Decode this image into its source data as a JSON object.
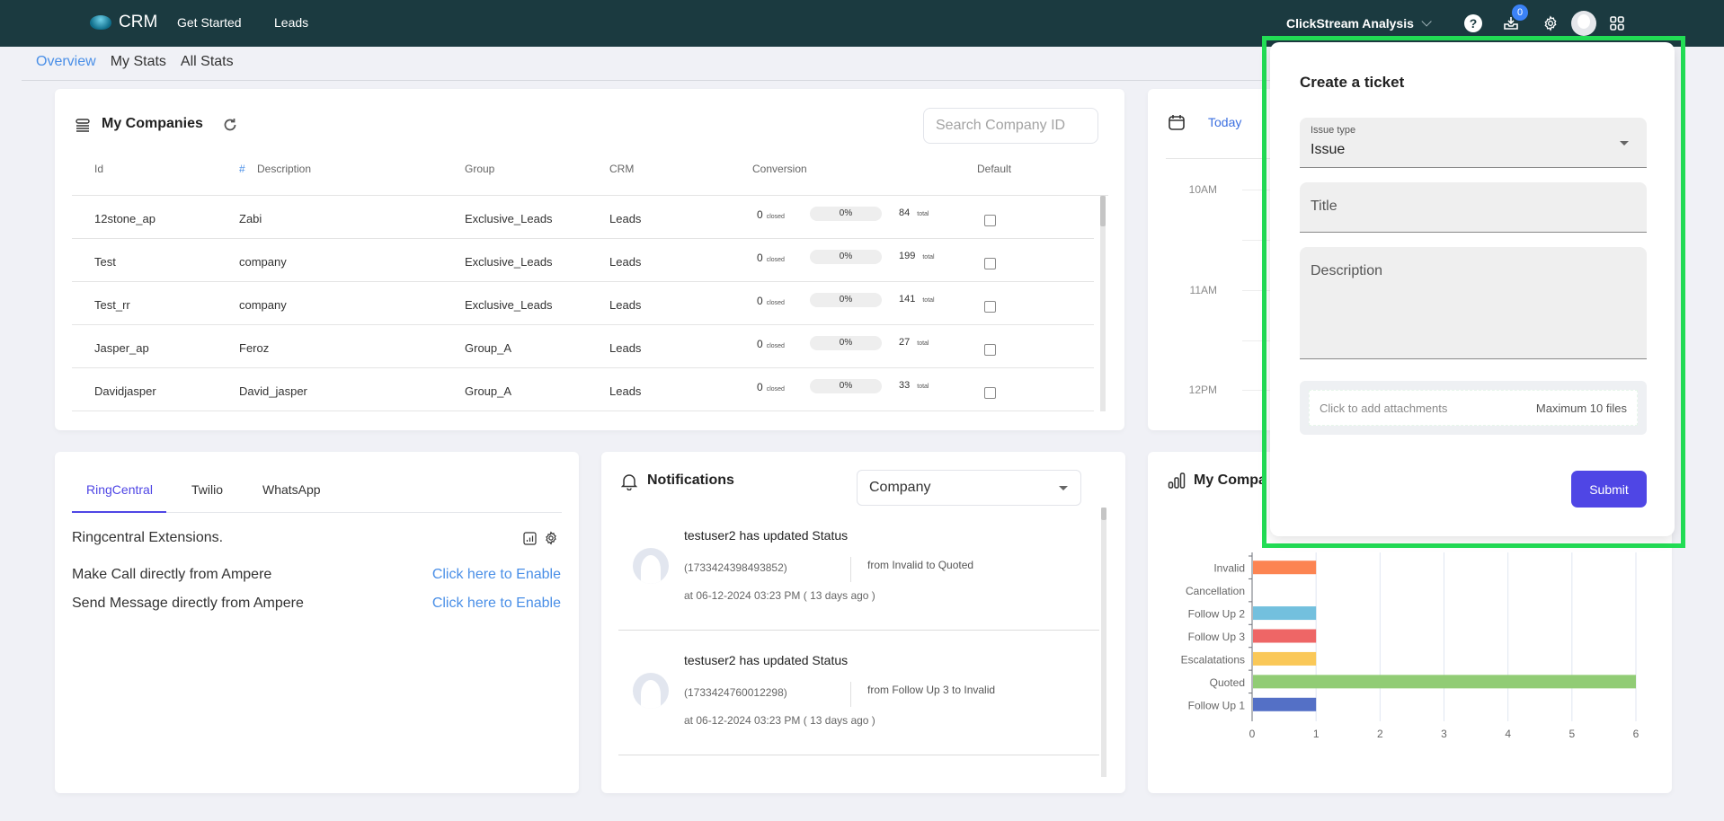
{
  "topnav": {
    "app_name": "CRM",
    "links": [
      "Get Started",
      "Leads"
    ],
    "workspace": "ClickStream Analysis",
    "inbox_badge": "0",
    "icons": [
      "help-icon",
      "inbox-download-icon",
      "gear-icon",
      "avatar",
      "apps-grid-icon"
    ]
  },
  "subtabs": [
    {
      "label": "Overview",
      "active": true
    },
    {
      "label": "My Stats",
      "active": false
    },
    {
      "label": "All Stats",
      "active": false
    }
  ],
  "companies": {
    "title": "My Companies",
    "search_placeholder": "Search Company ID",
    "columns": [
      "Id",
      "Description",
      "Group",
      "CRM",
      "Conversion",
      "Default"
    ],
    "closed_label": "closed",
    "total_label": "total",
    "rows": [
      {
        "id": "12stone_ap",
        "description": "Zabi",
        "group": "Exclusive_Leads",
        "crm": "Leads",
        "closed": "0",
        "percent": "0%",
        "total": "84",
        "default": false
      },
      {
        "id": "Test",
        "description": "company",
        "group": "Exclusive_Leads",
        "crm": "Leads",
        "closed": "0",
        "percent": "0%",
        "total": "199",
        "default": false
      },
      {
        "id": "Test_rr",
        "description": "company",
        "group": "Exclusive_Leads",
        "crm": "Leads",
        "closed": "0",
        "percent": "0%",
        "total": "141",
        "default": false
      },
      {
        "id": "Jasper_ap",
        "description": "Feroz",
        "group": "Group_A",
        "crm": "Leads",
        "closed": "0",
        "percent": "0%",
        "total": "27",
        "default": false
      },
      {
        "id": "Davidjasper",
        "description": "David_jasper",
        "group": "Group_A",
        "crm": "Leads",
        "closed": "0",
        "percent": "0%",
        "total": "33",
        "default": false
      }
    ]
  },
  "calendar": {
    "today_label": "Today",
    "times": [
      "10AM",
      "11AM",
      "12PM"
    ]
  },
  "ringcentral": {
    "tabs": [
      {
        "label": "RingCentral",
        "active": true
      },
      {
        "label": "Twilio",
        "active": false
      },
      {
        "label": "WhatsApp",
        "active": false
      }
    ],
    "heading": "Ringcentral Extensions.",
    "items": [
      {
        "text": "Make Call directly from Ampere",
        "link": "Click here to Enable"
      },
      {
        "text": "Send Message directly from Ampere",
        "link": "Click here to Enable"
      }
    ]
  },
  "notifications": {
    "title": "Notifications",
    "filter_value": "Company",
    "items": [
      {
        "title": "testuser2 has updated Status",
        "id": "(1733424398493852)",
        "date": "at 06-12-2024 03:23 PM ( 13 days ago )",
        "change": "from Invalid to Quoted"
      },
      {
        "title": "testuser2 has updated Status",
        "id": "(1733424760012298)",
        "date": "at 06-12-2024 03:23 PM ( 13 days ago )",
        "change": "from Follow Up 3 to Invalid"
      }
    ]
  },
  "chart_card": {
    "title": "My Compa"
  },
  "chart_data": {
    "type": "bar",
    "orientation": "horizontal",
    "title": "My Compa",
    "categories": [
      "Invalid",
      "Cancellation",
      "Follow Up 2",
      "Follow Up 3",
      "Escalatations",
      "Quoted",
      "Follow Up 1"
    ],
    "values": [
      1,
      0,
      1,
      1,
      1,
      6,
      1
    ],
    "colors": [
      "#fc8452",
      "#cccccc",
      "#73c0de",
      "#ee6666",
      "#fac858",
      "#91cc75",
      "#5470c6"
    ],
    "xlim": [
      0,
      6
    ],
    "xticks": [
      "0",
      "1",
      "2",
      "3",
      "4",
      "5",
      "6"
    ],
    "xlabel": "",
    "ylabel": "",
    "grid": true
  },
  "modal": {
    "title": "Create a ticket",
    "issue_type_label": "Issue type",
    "issue_type_value": "Issue",
    "title_placeholder": "Title",
    "description_placeholder": "Description",
    "attach_text": "Click to add attachments",
    "attach_limit": "Maximum 10 files",
    "submit_label": "Submit",
    "highlight_color": "#22dd55",
    "accent_color": "#4f46e5"
  }
}
